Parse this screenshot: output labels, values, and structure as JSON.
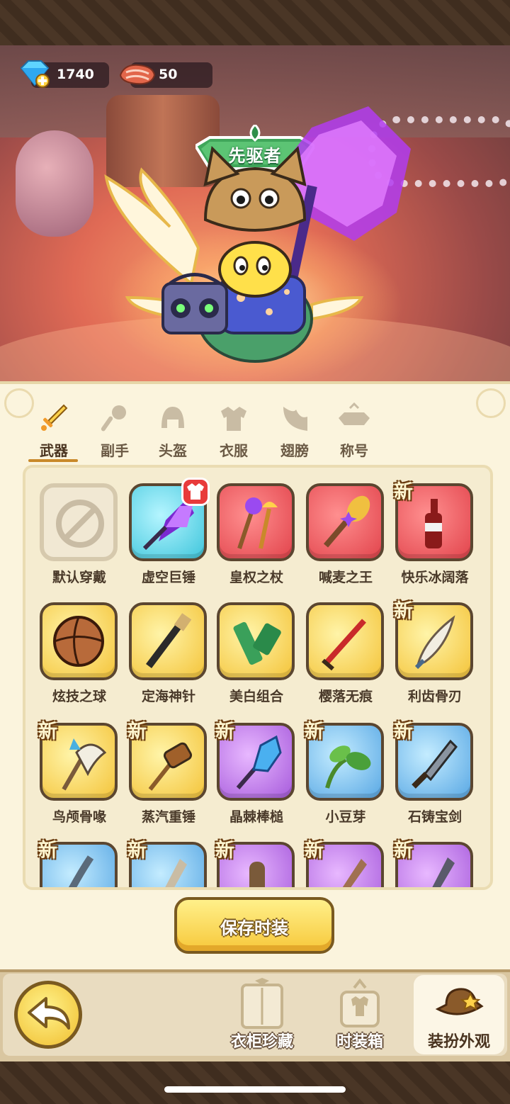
{
  "resources": {
    "gems": "1740",
    "meat": "50"
  },
  "character_title": "先驱者",
  "tabs": [
    {
      "label": "武器",
      "active": true
    },
    {
      "label": "副手",
      "active": false
    },
    {
      "label": "头盔",
      "active": false
    },
    {
      "label": "衣服",
      "active": false
    },
    {
      "label": "翅膀",
      "active": false
    },
    {
      "label": "称号",
      "active": false
    }
  ],
  "items": [
    {
      "name": "默认穿戴",
      "rarity": "default",
      "new": false
    },
    {
      "name": "虚空巨锤",
      "rarity": "cyan",
      "new": false,
      "equipped_badge": "shirt-icon"
    },
    {
      "name": "皇权之杖",
      "rarity": "red",
      "new": false
    },
    {
      "name": "喊麦之王",
      "rarity": "red",
      "new": false
    },
    {
      "name": "快乐冰阔落",
      "rarity": "red",
      "new": true
    },
    {
      "name": "炫技之球",
      "rarity": "yellow",
      "new": false
    },
    {
      "name": "定海神针",
      "rarity": "yellow",
      "new": false
    },
    {
      "name": "美白组合",
      "rarity": "yellow",
      "new": false
    },
    {
      "name": "樱落无痕",
      "rarity": "yellow",
      "new": false
    },
    {
      "name": "利齿骨刃",
      "rarity": "yellow",
      "new": true
    },
    {
      "name": "鸟颅骨喙",
      "rarity": "yellow",
      "new": true
    },
    {
      "name": "蒸汽重锤",
      "rarity": "yellow",
      "new": true
    },
    {
      "name": "晶棘棒槌",
      "rarity": "purple",
      "new": true
    },
    {
      "name": "小豆芽",
      "rarity": "blue",
      "new": true
    },
    {
      "name": "石铸宝剑",
      "rarity": "blue",
      "new": true
    },
    {
      "name": "",
      "rarity": "blue",
      "new": true
    },
    {
      "name": "",
      "rarity": "blue",
      "new": true
    },
    {
      "name": "",
      "rarity": "purple",
      "new": true
    },
    {
      "name": "",
      "rarity": "purple",
      "new": true
    },
    {
      "name": "",
      "rarity": "purple",
      "new": true
    }
  ],
  "new_label": "新",
  "save_button": "保存时装",
  "bottom_nav": [
    {
      "label": "衣柜珍藏",
      "icon": "wardrobe-icon",
      "active": false
    },
    {
      "label": "时装箱",
      "icon": "fashion-box-icon",
      "active": false
    },
    {
      "label": "装扮外观",
      "icon": "hat-icon",
      "active": true
    }
  ],
  "colors": {
    "panel": "#fbf4dd",
    "accent": "#c9892a",
    "gold_button": "#f7c83a"
  }
}
